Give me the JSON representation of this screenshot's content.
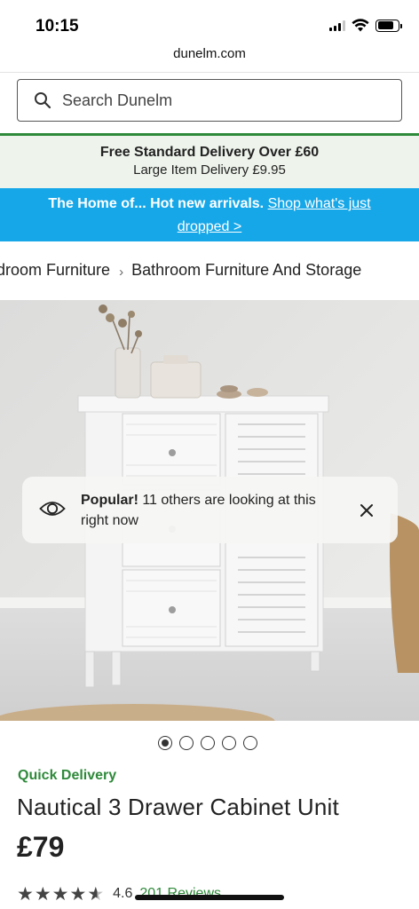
{
  "status_bar": {
    "time": "10:15",
    "icons": [
      "signal-icon",
      "wifi-icon",
      "battery-icon"
    ]
  },
  "browser": {
    "url": "dunelm.com"
  },
  "search": {
    "placeholder": "Search Dunelm",
    "icon": "search-icon"
  },
  "delivery_banner": {
    "line1": "Free Standard Delivery Over £60",
    "line2": "Large Item Delivery £9.95",
    "accent_color": "#2e8a3a",
    "background_color": "#eef4ec"
  },
  "promo_banner": {
    "text": "The Home of... Hot new arrivals.",
    "link_text": "Shop what's just dropped >",
    "background_color": "#16a7e8"
  },
  "breadcrumb": {
    "items": [
      "Bedroom Furniture",
      "Bathroom Furniture And Storage"
    ],
    "separator": "›"
  },
  "product_image": {
    "description_icon": "bathroom-cabinet-photo"
  },
  "popular_toast": {
    "bold": "Popular!",
    "text": "11 others are looking at this right now",
    "icon": "eye-icon",
    "close_icon": "close-icon"
  },
  "carousel": {
    "count": 5,
    "active_index": 0
  },
  "product": {
    "badge": "Quick Delivery",
    "title": "Nautical 3 Drawer Cabinet Unit",
    "price": "£79",
    "rating": "4.6",
    "rating_stars": 4.6,
    "reviews": "201 Reviews",
    "brand_color": "#2e8a3a"
  }
}
